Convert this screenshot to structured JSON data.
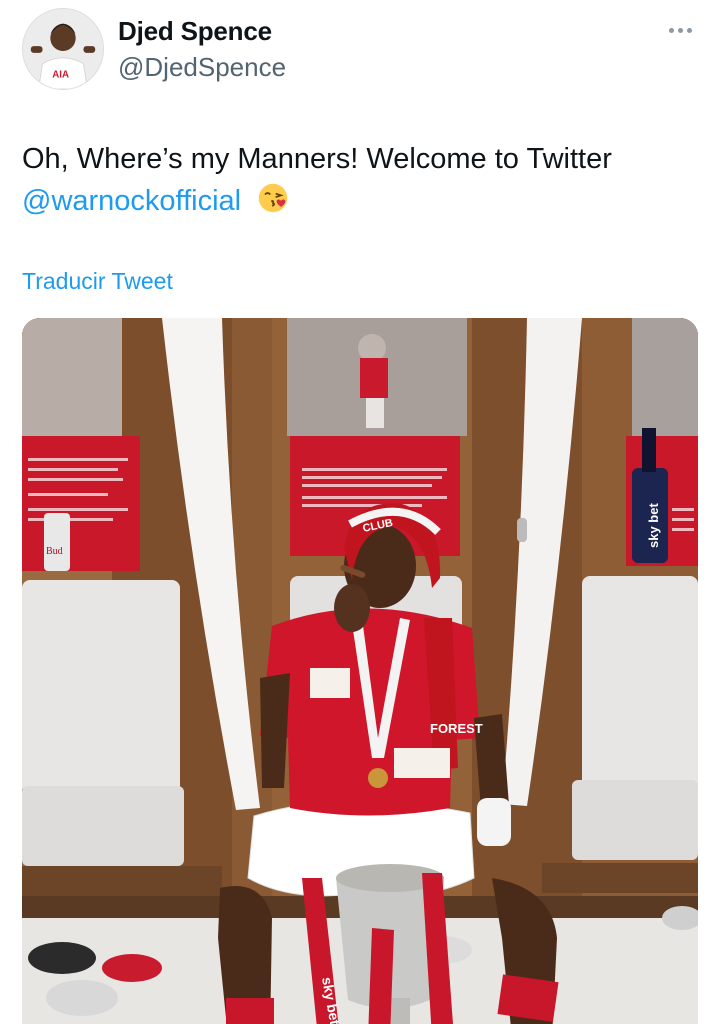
{
  "author": {
    "display_name": "Djed Spence",
    "handle": "@DjedSpence",
    "avatar_jersey_text": "AIA"
  },
  "tweet": {
    "text_line1": "Oh, Where’s my Manners! Welcome to Twitter",
    "mention": "@warnockofficial",
    "emoji": "kissing-face-emoji"
  },
  "actions": {
    "translate_label": "Traducir Tweet"
  },
  "media": {
    "description_icon": "photo",
    "sponsor_text": "sky bet",
    "club_text": "FOREST",
    "scarf_text": "CLUB",
    "bottle_label": "Bud"
  },
  "colors": {
    "accent": "#1d9bf0",
    "text": "#0f1419",
    "secondary": "#536471",
    "forest_red": "#d0162a"
  }
}
